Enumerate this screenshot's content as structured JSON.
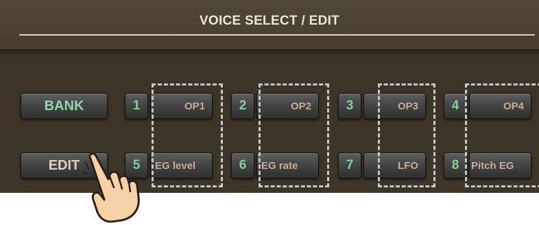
{
  "header": {
    "title": "VOICE SELECT / EDIT"
  },
  "left_buttons": {
    "bank_label": "BANK",
    "edit_label": "EDIT"
  },
  "slots": [
    {
      "number": "1",
      "label": "OP1"
    },
    {
      "number": "2",
      "label": "OP2"
    },
    {
      "number": "3",
      "label": "OP3"
    },
    {
      "number": "4",
      "label": "OP4"
    },
    {
      "number": "5",
      "label": "EG level"
    },
    {
      "number": "6",
      "label": "EG rate"
    },
    {
      "number": "7",
      "label": "LFO"
    },
    {
      "number": "8",
      "label": "Pitch EG"
    }
  ],
  "colors": {
    "panel_background": "#3d3628",
    "number_color": "#7bd39b",
    "label_color": "#c9ad93",
    "dashed_outline": "#c8c8c8"
  },
  "icons": {
    "pointer": "pointing-hand-icon"
  }
}
